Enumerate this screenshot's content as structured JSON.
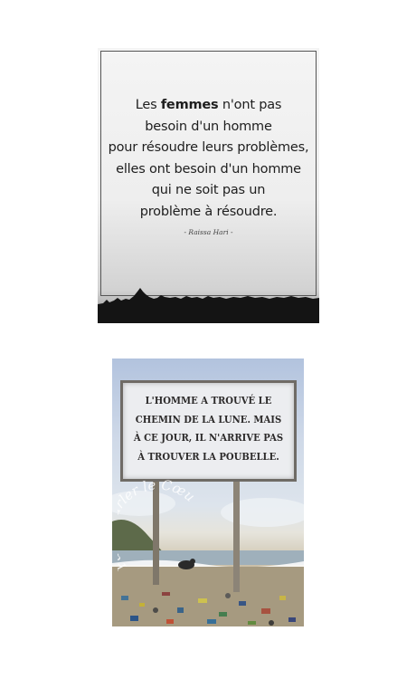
{
  "quote_card": {
    "lines": [
      {
        "pre": "Les ",
        "bold": "femmes",
        "post": " n'ont pas"
      },
      {
        "pre": "besoin d'un homme",
        "bold": "",
        "post": ""
      },
      {
        "pre": "pour résoudre leurs problèmes,",
        "bold": "",
        "post": ""
      },
      {
        "pre": "elles ont besoin d'un homme",
        "bold": "",
        "post": ""
      },
      {
        "pre": "qui ne soit pas un",
        "bold": "",
        "post": ""
      },
      {
        "pre": "problème à résoudre.",
        "bold": "",
        "post": ""
      }
    ],
    "author": "- Raissa Hari -"
  },
  "sign_card": {
    "lines": [
      "L'HOMME A TROUVÉ LE",
      "CHEMIN DE LA LUNE. MAIS",
      "À CE JOUR, IL N'ARRIVE PAS",
      "À TROUVER LA POUBELLE."
    ],
    "watermark": "Pause Parler le Cœur"
  }
}
